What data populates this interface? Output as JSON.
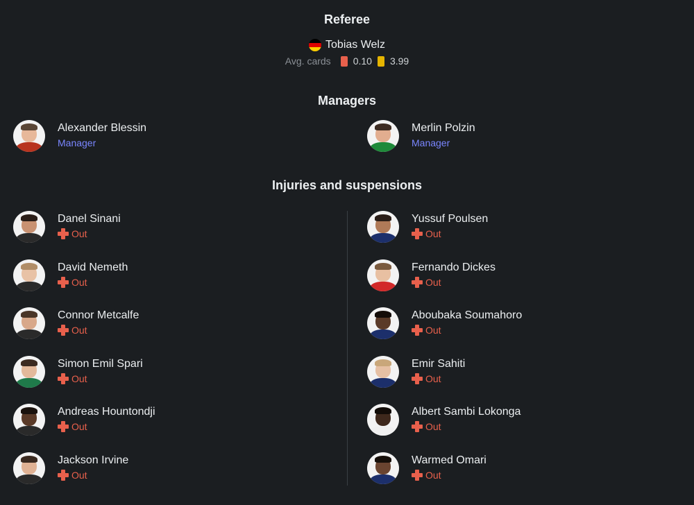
{
  "referee": {
    "title": "Referee",
    "name": "Tobias Welz",
    "flag_colors": [
      "#000000",
      "#dd0000",
      "#ffce00"
    ],
    "avg_cards_label": "Avg. cards",
    "red_avg": "0.10",
    "yellow_avg": "3.99",
    "red_color": "#e8604c",
    "yellow_color": "#e5b400"
  },
  "managers": {
    "title": "Managers",
    "items": [
      {
        "name": "Alexander Blessin",
        "role": "Manager"
      },
      {
        "name": "Merlin Polzin",
        "role": "Manager"
      }
    ]
  },
  "injuries": {
    "title": "Injuries and suspensions",
    "left": [
      {
        "name": "Danel Sinani",
        "status": "Out"
      },
      {
        "name": "David Nemeth",
        "status": "Out"
      },
      {
        "name": "Connor Metcalfe",
        "status": "Out"
      },
      {
        "name": "Simon Emil Spari",
        "status": "Out"
      },
      {
        "name": "Andreas Hountondji",
        "status": "Out"
      },
      {
        "name": "Jackson Irvine",
        "status": "Out"
      }
    ],
    "right": [
      {
        "name": "Yussuf Poulsen",
        "status": "Out"
      },
      {
        "name": "Fernando Dickes",
        "status": "Out"
      },
      {
        "name": "Aboubaka Soumahoro",
        "status": "Out"
      },
      {
        "name": "Emir Sahiti",
        "status": "Out"
      },
      {
        "name": "Albert Sambi Lokonga",
        "status": "Out"
      },
      {
        "name": "Warmed Omari",
        "status": "Out"
      }
    ]
  },
  "colors": {
    "background": "#1b1e21",
    "manager_role": "#7a86ff",
    "status_out": "#e8604c"
  }
}
